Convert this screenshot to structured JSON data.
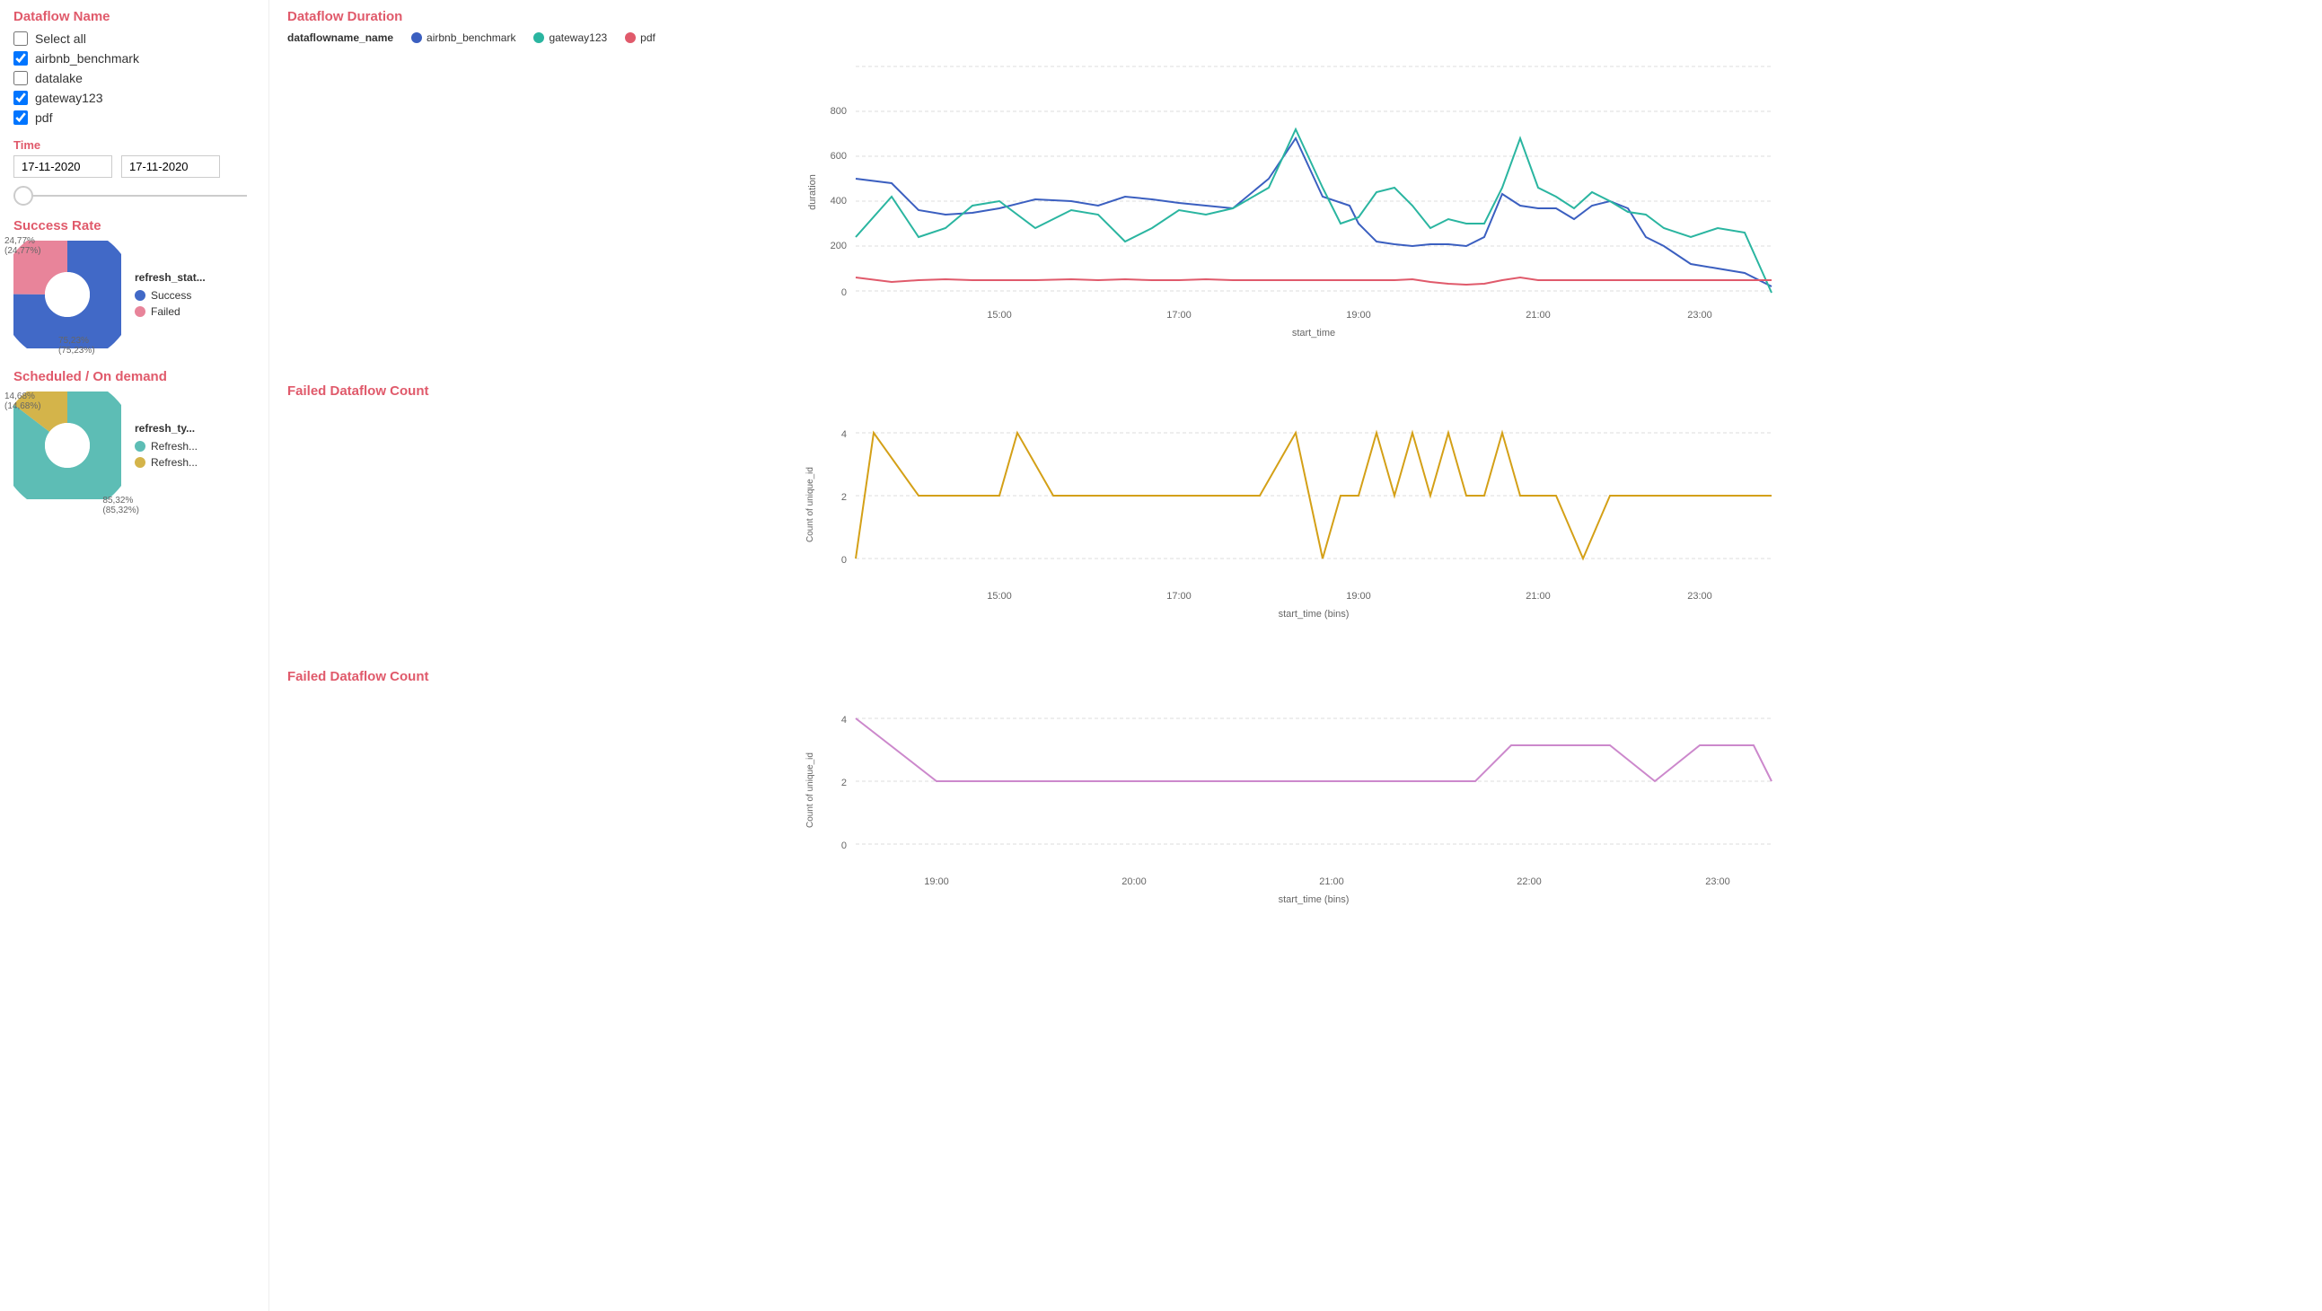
{
  "sidebar": {
    "dataflow_title": "Dataflow Name",
    "select_all_label": "Select all",
    "items": [
      {
        "label": "airbnb_benchmark",
        "checked": true
      },
      {
        "label": "datalake",
        "checked": false
      },
      {
        "label": "gateway123",
        "checked": true
      },
      {
        "label": "pdf",
        "checked": true
      }
    ],
    "time_title": "Time",
    "date_start": "17-11-2020",
    "date_end": "17-11-2020"
  },
  "success_rate": {
    "title": "Success Rate",
    "legend_title": "refresh_stat...",
    "segments": [
      {
        "label": "Success",
        "value": 75.23,
        "color": "#4169c7"
      },
      {
        "label": "Failed",
        "value": 24.77,
        "color": "#e8849a"
      }
    ],
    "annotations": [
      {
        "text": "24,77%",
        "sub": "(24,77%)"
      },
      {
        "text": "75,23%",
        "sub": "(75,23%)"
      }
    ]
  },
  "scheduled": {
    "title": "Scheduled / On demand",
    "legend_title": "refresh_ty...",
    "segments": [
      {
        "label": "Refresh...",
        "value": 85.32,
        "color": "#5dbdb5"
      },
      {
        "label": "Refresh...",
        "value": 14.68,
        "color": "#d4b44a"
      }
    ],
    "annotations": [
      {
        "text": "14,68%",
        "sub": "(14,68%)"
      },
      {
        "text": "85,32%",
        "sub": "(85,32%)"
      }
    ]
  },
  "dataflow_duration": {
    "title": "Dataflow Duration",
    "legend_label": "dataflowname_name",
    "legend_items": [
      {
        "label": "airbnb_benchmark",
        "color": "#3b5fc0"
      },
      {
        "label": "gateway123",
        "color": "#2ab5a0"
      },
      {
        "label": "pdf",
        "color": "#e05a6b"
      }
    ],
    "y_label": "duration",
    "x_label": "start_time",
    "x_ticks": [
      "15:00",
      "17:00",
      "19:00",
      "21:00",
      "23:00"
    ],
    "y_ticks": [
      "0",
      "200",
      "400",
      "600",
      "800"
    ]
  },
  "failed_count_1": {
    "title": "Failed Dataflow Count",
    "y_label": "Count of unique_id",
    "x_label": "start_time (bins)",
    "x_ticks": [
      "15:00",
      "17:00",
      "19:00",
      "21:00",
      "23:00"
    ],
    "y_ticks": [
      "0",
      "2",
      "4"
    ],
    "line_color": "#d4a017"
  },
  "failed_count_2": {
    "title": "Failed Dataflow Count",
    "y_label": "Count of unique_id",
    "x_label": "start_time (bins)",
    "x_ticks": [
      "19:00",
      "20:00",
      "21:00",
      "22:00",
      "23:00"
    ],
    "y_ticks": [
      "0",
      "2",
      "4"
    ],
    "line_color": "#cc88cc"
  }
}
